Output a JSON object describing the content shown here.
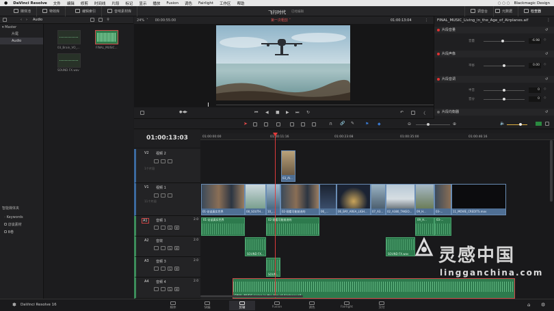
{
  "menubar": {
    "app": "DaVinci Resolve",
    "items": [
      "文件",
      "编辑",
      "修剪",
      "时间线",
      "片段",
      "标记",
      "显示",
      "播放",
      "Fusion",
      "调色",
      "Fairlight",
      "工作区",
      "帮助"
    ],
    "product": "Blackmagic Design"
  },
  "toolbar": {
    "media_pool": "媒体池",
    "effects": "特效库",
    "edit_index": "编辑索引",
    "sound_library": "音响素材库",
    "project_title": "飞行时代",
    "project_subtitle": "已经编辑",
    "mixer": "调音台",
    "metadata": "元数据",
    "inspector": "检查器"
  },
  "media": {
    "folder": "Audio",
    "master": "Master",
    "bins": [
      "片尾",
      "Audio"
    ],
    "clips": [
      "03_Brain_VO_...",
      "FINAL_MUSIC...",
      "SOUND FX.wav"
    ],
    "smart_bins": "智能媒体夹",
    "smart_items": [
      "Keywords",
      "访谈素材",
      "B卷"
    ]
  },
  "viewer": {
    "zoom": "24%",
    "duration": "00:00:55:00",
    "timeline_name": "第一次粗剪",
    "timecode": "01:00:13:04"
  },
  "inspector": {
    "clip_name": "FINAL_MUSIC_Living_in_the_Age_of_Airplanes.aif",
    "sections": [
      "片段音量",
      "片段声像",
      "片段音调",
      "片段均衡器"
    ],
    "volume_label": "音量",
    "volume_value": "-6.98",
    "pan_label": "平移",
    "pan_value": "0.00",
    "pitch_label1": "半音",
    "pitch_value1": "0",
    "pitch_label2": "音分",
    "pitch_value2": "0"
  },
  "timeline": {
    "timecode": "01:00:13:03",
    "ruler": [
      "01:00:00:00",
      "01:00:11:16",
      "01:00:23:08",
      "01:00:35:00",
      "01:00:46:16"
    ],
    "tracks": [
      {
        "id": "V2",
        "name": "视频 2",
        "count": "1个片段"
      },
      {
        "id": "V1",
        "name": "视频 1",
        "count": "11个片段"
      },
      {
        "id": "A1",
        "name": "音频 1",
        "level": "2.0"
      },
      {
        "id": "A2",
        "name": "音效",
        "level": "2.0"
      },
      {
        "id": "A3",
        "name": "音频 3",
        "level": "2.0"
      },
      {
        "id": "A4",
        "name": "音频 4",
        "level": "2.0"
      }
    ],
    "v2_clip": "03_AI...",
    "v1_clips": [
      "01-访谈真实世界",
      "08_SOUTH...",
      "10_...",
      "02-观看可能前进的",
      "06_...",
      "06_BAY_AREA_LIGH...",
      "07_A3...",
      "02_A380_TAKEO...",
      "09_H...",
      "03-...",
      "11_MOVIE_CREDITS.mov"
    ],
    "a1_clips": [
      "01-访谈真实世界",
      "02-观看可能前进的",
      "09_H...",
      "03-..."
    ],
    "a2_clips": [
      "SOUND FX...",
      "SOUND FX.wav"
    ],
    "a3_clip": "SOUN...",
    "a4_clip": "FINAL_MUSIC_Living_in_the_Age_of_Airplanes.aif"
  },
  "pages": [
    "媒体",
    "快编",
    "剪辑",
    "Fusion",
    "调色",
    "Fairlight",
    "交付"
  ],
  "active_page": "剪辑",
  "footer": {
    "app": "DaVinci Resolve 16"
  },
  "watermark": {
    "main": "灵感中国",
    "sub": "lingganchina.com"
  }
}
